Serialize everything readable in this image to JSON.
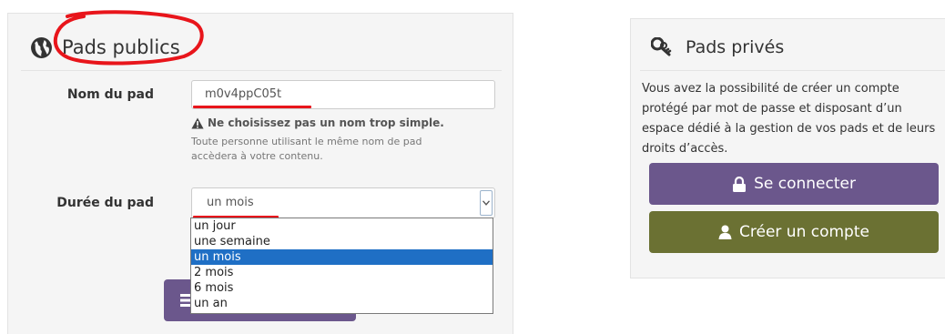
{
  "public": {
    "title": "Pads publics",
    "name_label": "Nom du pad",
    "name_value": "m0v4ppC05t",
    "warning": "Ne choisissez pas un nom trop simple.",
    "help_line1": "Toute personne utilisant le même nom de pad",
    "help_line2": "accèdera à votre contenu.",
    "duration_label": "Durée du pad",
    "duration_selected": "un mois",
    "duration_options": [
      "un jour",
      "une semaine",
      "un mois",
      "2 mois",
      "6 mois",
      "un an"
    ],
    "submit_icon": "list-icon"
  },
  "private": {
    "title": "Pads privés",
    "description": "Vous avez la possibilité de créer un compte protégé par mot de passe et disposant d’un espace dédié à la gestion de vos pads et de leurs droits d’accès.",
    "login_label": "Se connecter",
    "signup_label": "Créer un compte",
    "login_icon": "lock-icon",
    "signup_icon": "user-icon"
  },
  "colors": {
    "login_button": "#6b578c",
    "signup_button": "#6b7133",
    "annotation": "#e8151b",
    "selected_option": "#1f6fc5"
  }
}
